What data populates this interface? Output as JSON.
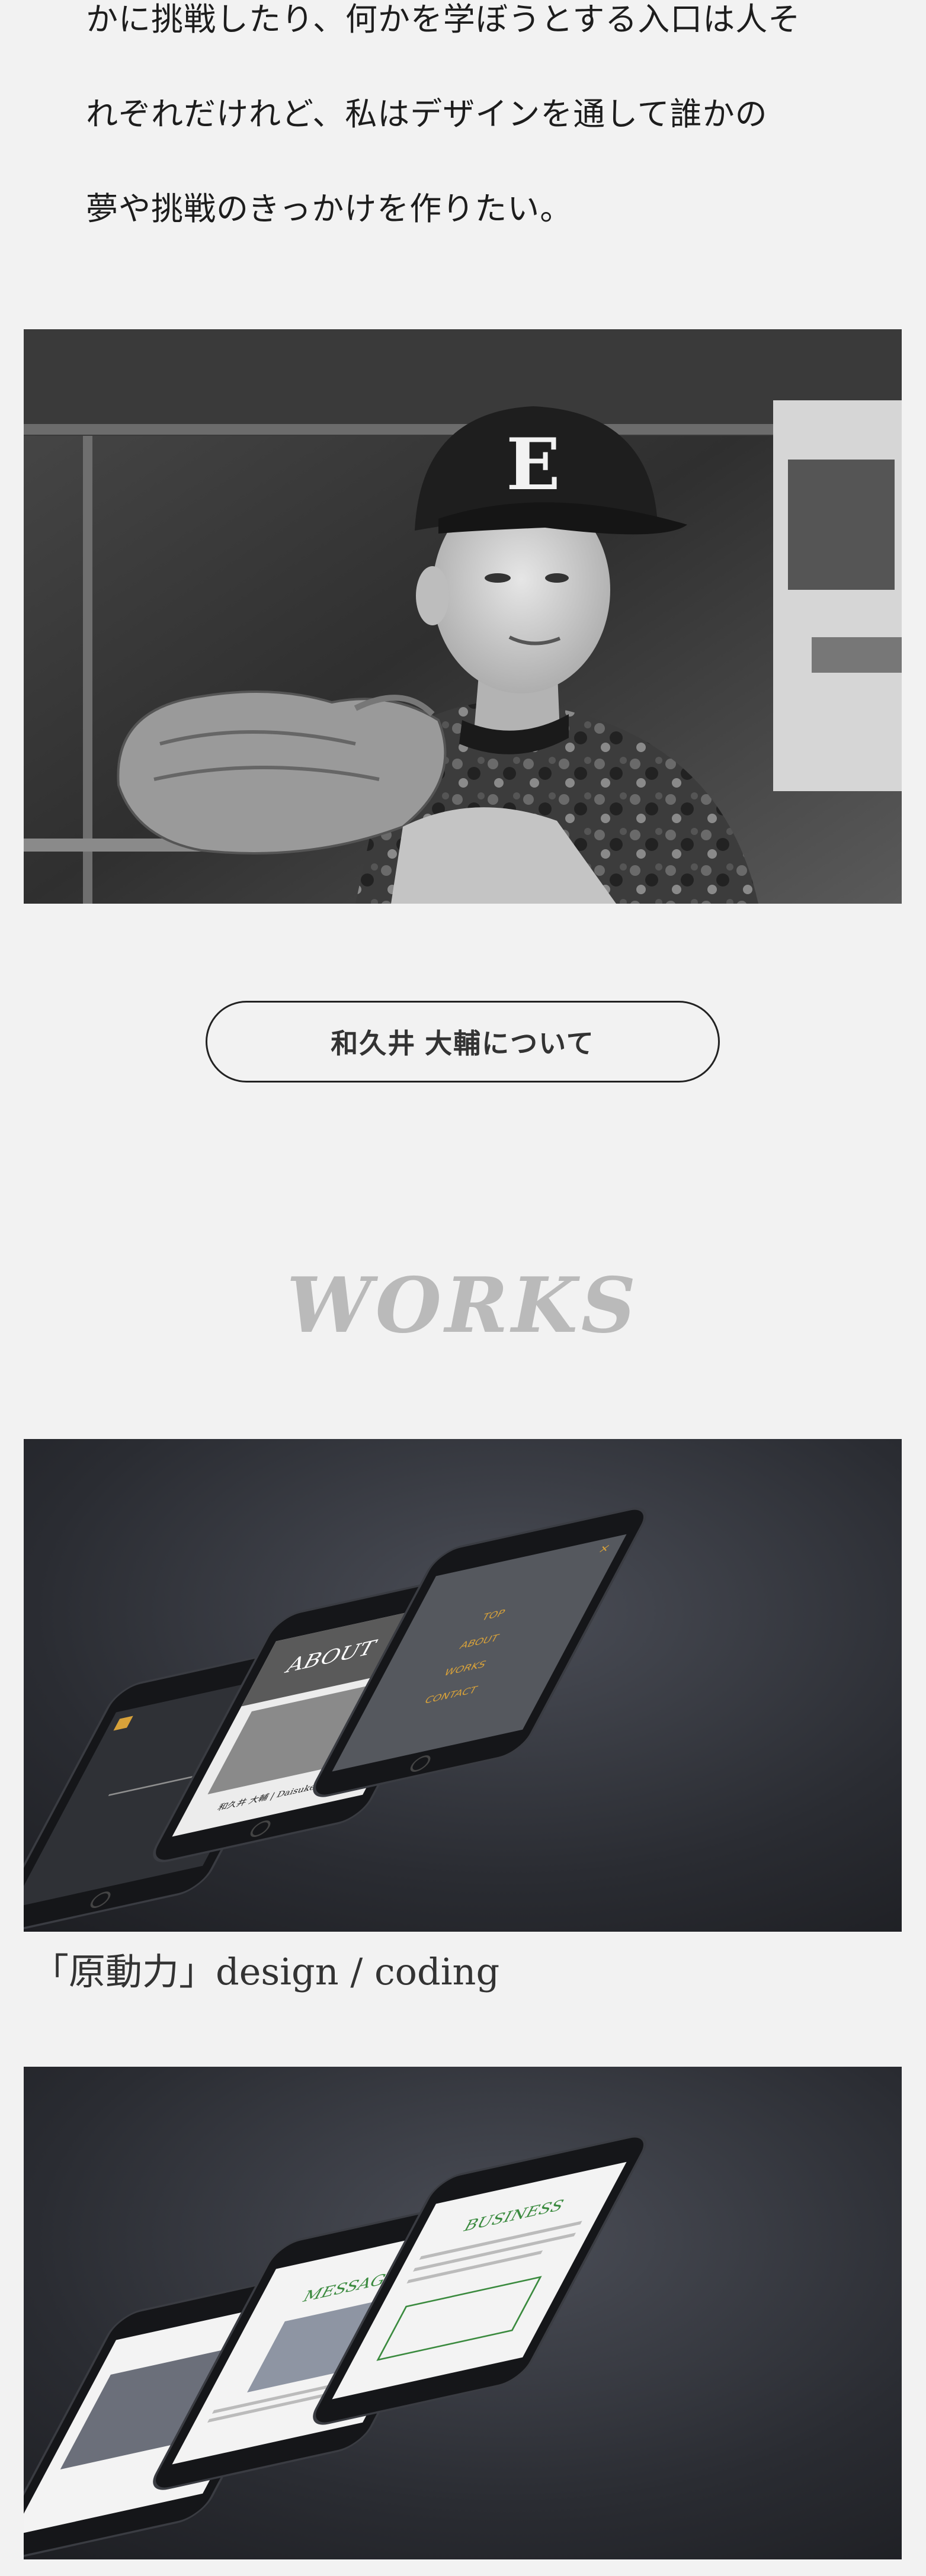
{
  "intro": {
    "lines": [
      "かに挑戦したり、何かを学ぼうとする入口は人そ",
      "れぞれだけれど、私はデザインを通して誰かの",
      "夢や挑戦のきっかけを作りたい。"
    ]
  },
  "about_button": {
    "label": "和久井 大輔について"
  },
  "works": {
    "title": "WORKS",
    "items": [
      {
        "caption": "「原動力」design / coding",
        "mockup": {
          "about_heading": "ABOUT",
          "menu_items": [
            "TOP",
            "ABOUT",
            "WORKS",
            "CONTACT"
          ],
          "name_line": "和久井 大輔 | Daisuke Wakui"
        }
      },
      {
        "caption": "",
        "mockup": {
          "heading": "BUSINESS",
          "message_heading": "MESSAGE"
        }
      }
    ]
  },
  "colors": {
    "background": "#f2f2f2",
    "text": "#222222",
    "works_title": "#bababa",
    "mockup_accent": "#d8a23a",
    "mockup_green": "#3a8a3e"
  }
}
